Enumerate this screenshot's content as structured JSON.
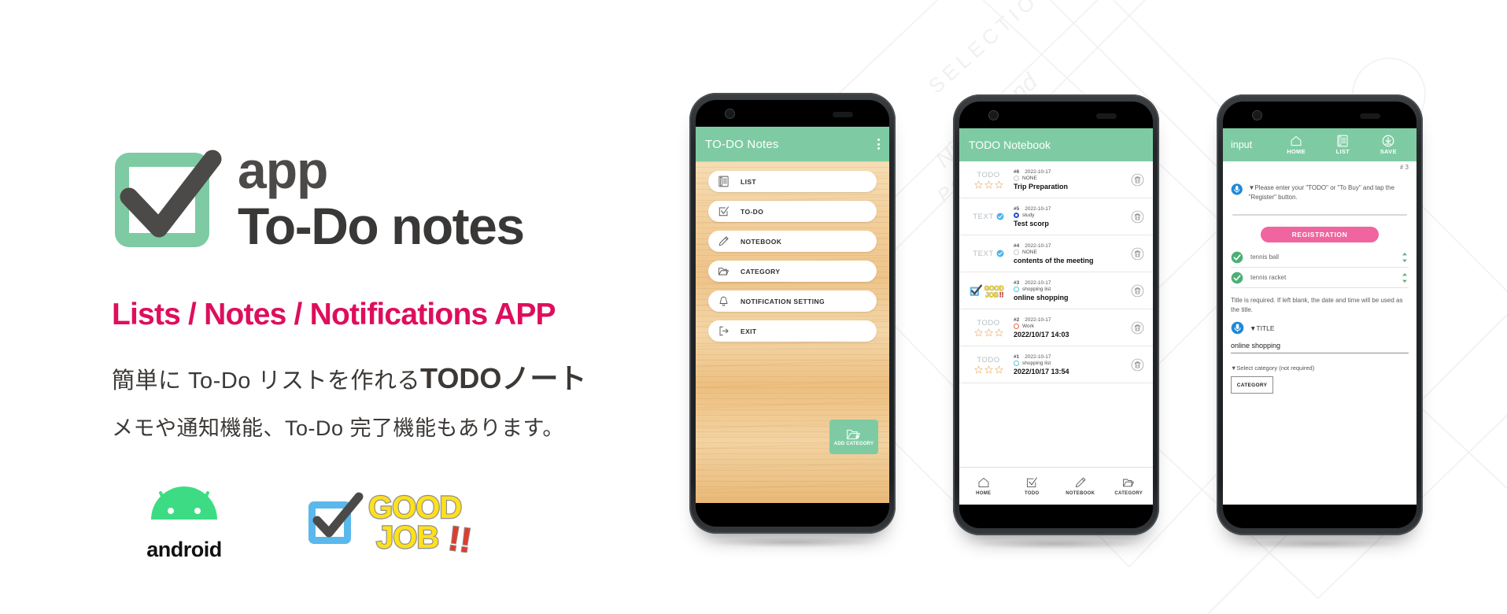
{
  "brand": {
    "logo_line1": "app",
    "logo_line2": "To-Do notes",
    "tagline": "Lists / Notes / Notifications APP",
    "jp_line1_pre": "簡単に To-Do リストを作れる",
    "jp_line1_strong": "TODOノート",
    "jp_line2": "メモや通知機能、To-Do 完了機能もあります。",
    "android_label": "android",
    "goodjob_line1": "GOOD",
    "goodjob_line2": "JOB",
    "goodjob_bangs": "!!",
    "colors": {
      "green": "#7ecba3",
      "magenta": "#de0e5d",
      "dark": "#4c4a49",
      "android_green": "#3ddc84",
      "goodjob_yellow": "#ffe01b",
      "goodjob_blue": "#5bb8ec",
      "pink_button": "#f0649f"
    }
  },
  "watermark": {
    "text1": "SELECTION",
    "text2": "Night Grand",
    "text3": "Palais"
  },
  "phone1": {
    "appbar_title": "TO-DO Notes",
    "overflow_icon": "more-vertical-icon",
    "menu": [
      {
        "label": "LIST",
        "icon": "list-icon"
      },
      {
        "label": "TO-DO",
        "icon": "checkbox-icon"
      },
      {
        "label": "NOTEBOOK",
        "icon": "pencil-icon"
      },
      {
        "label": "CATEGORY",
        "icon": "folder-icon"
      },
      {
        "label": "NOTIFICATION SETTING",
        "icon": "bell-icon"
      },
      {
        "label": "EXIT",
        "icon": "exit-icon"
      }
    ],
    "fab": {
      "label": "ADD CATEGORY",
      "icon": "folder-add-icon"
    }
  },
  "phone2": {
    "appbar_title": "TODO Notebook",
    "items": [
      {
        "kind": "TODO",
        "kind_style": "stars",
        "id": "#6",
        "date": "2022-10-17",
        "category": "NONE",
        "category_color": "#c9c9c9",
        "name": "Trip Preparation"
      },
      {
        "kind": "TEXT",
        "kind_style": "check",
        "id": "#5",
        "date": "2022-10-17",
        "category": "study",
        "category_color": "#2b4fd6",
        "name": "Test scorp"
      },
      {
        "kind": "TEXT",
        "kind_style": "check",
        "id": "#4",
        "date": "2022-10-17",
        "category": "NONE",
        "category_color": "#c9c9c9",
        "name": "contents of the meeting"
      },
      {
        "kind": "",
        "kind_style": "goodjob",
        "id": "#3",
        "date": "2022-10-17",
        "category": "shopping list",
        "category_color": "#55c5e0",
        "name": "online shopping"
      },
      {
        "kind": "TODO",
        "kind_style": "stars",
        "id": "#2",
        "date": "2022-10-17",
        "category": "Work",
        "category_color": "#f0634f",
        "name": "2022/10/17 14:03"
      },
      {
        "kind": "TODO",
        "kind_style": "stars",
        "id": "#1",
        "date": "2022-10-17",
        "category": "shopping list",
        "category_color": "#55c5e0",
        "name": "2022/10/17 13:54"
      }
    ],
    "nav": [
      {
        "label": "HOME",
        "icon": "home-icon"
      },
      {
        "label": "TODO",
        "icon": "checkbox-icon"
      },
      {
        "label": "NOTEBOOK",
        "icon": "pencil-icon"
      },
      {
        "label": "CATEGORY",
        "icon": "folder-icon"
      }
    ],
    "delete_icon": "trash-icon"
  },
  "phone3": {
    "appbar_title": "input",
    "actions": [
      {
        "label": "HOME",
        "icon": "home-icon"
      },
      {
        "label": "LIST",
        "icon": "list-icon"
      },
      {
        "label": "SAVE",
        "icon": "save-download-icon"
      }
    ],
    "record_number": "# 3",
    "hint_text": "▼Please enter your \"TODO\" or \"To Buy\" and tap the \"Register\" button.",
    "mic_icon": "microphone-icon",
    "register_button": "REGISTRATION",
    "checklist": [
      {
        "label": "tennis ball",
        "checked": true
      },
      {
        "label": "tennis racket",
        "checked": true
      }
    ],
    "note": "Title is required. If left blank, the date and time will be used as the title.",
    "title_label": "▼TITLE",
    "title_value": "online shopping",
    "select_category_label": "▼Select category (not required)",
    "category_button": "CATEGORY"
  }
}
